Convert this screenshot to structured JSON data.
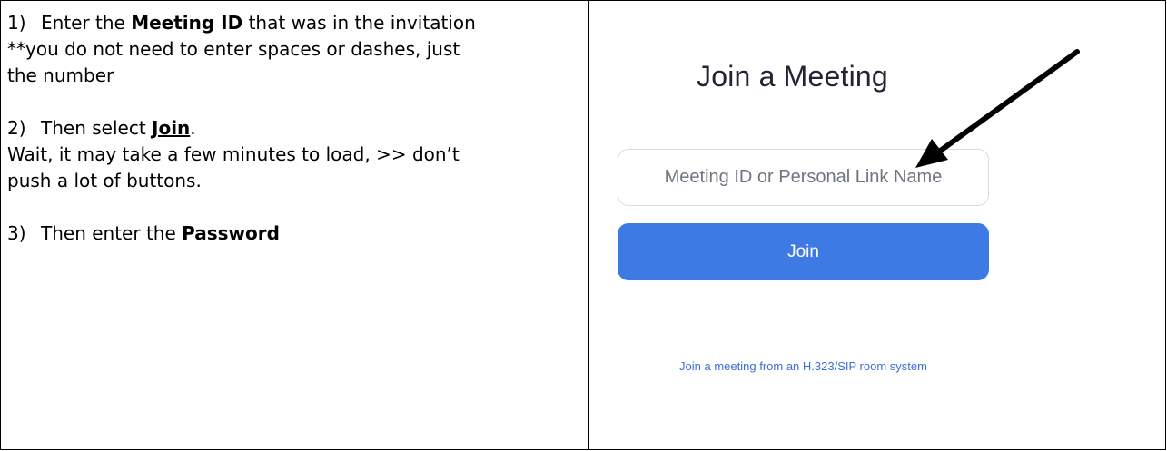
{
  "instructions": {
    "step1": {
      "num": "1)",
      "pre": "Enter the ",
      "bold": "Meeting ID",
      "post": " that was in the invitation",
      "note_line1": "**you do not need to enter spaces or dashes, just",
      "note_line2": "the number"
    },
    "step2": {
      "num": "2)",
      "pre": "Then select ",
      "bold": "Join",
      "post": ".",
      "note_line1": "Wait, it may take a few minutes to load, >> don’t",
      "note_line2": "push a lot of buttons."
    },
    "step3": {
      "num": "3)",
      "pre": "Then enter the ",
      "bold": "Password"
    }
  },
  "zoom": {
    "title": "Join a Meeting",
    "meeting_id_placeholder": "Meeting ID or Personal Link Name",
    "join_label": "Join",
    "sip_link": "Join a meeting from an H.323/SIP room system"
  },
  "icons": {
    "annotation": "arrow-icon"
  },
  "colors": {
    "join_button": "#3e7ae4",
    "link": "#3d6fd6",
    "title": "#232333"
  }
}
